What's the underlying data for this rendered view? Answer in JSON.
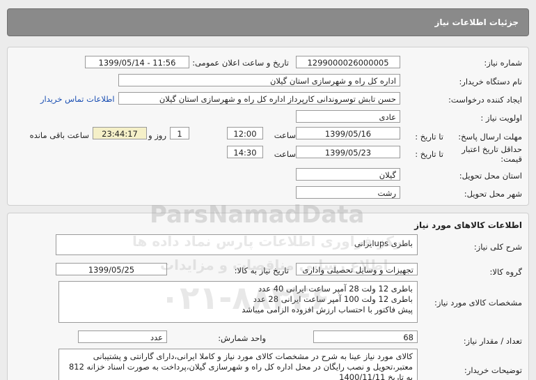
{
  "header": {
    "title": "جزئیات اطلاعات نیاز"
  },
  "need": {
    "need_number_label": "شماره نیاز:",
    "need_number": "1299000026000005",
    "announce_label": "تاریخ و ساعت اعلان عمومی:",
    "announce_value": "1399/05/14 - 11:56",
    "buyer_label": "نام دستگاه خریدار:",
    "buyer_value": "اداره کل راه و شهرسازی استان گیلان",
    "creator_label": "ایجاد کننده درخواست:",
    "creator_value": "حسن تابش توسروندانی کارپرداز اداره کل راه و شهرسازی استان گیلان",
    "contact_link": "اطلاعات تماس خریدار",
    "priority_label": "اولویت نیاز :",
    "priority_value": "عادی",
    "deadline_label": "مهلت ارسال پاسخ:",
    "to_date_label": "تا تاریخ :",
    "deadline_date": "1399/05/16",
    "time_label": "ساعت",
    "deadline_time": "12:00",
    "days_value": "1",
    "days_label": "روز و",
    "remaining_time": "23:44:17",
    "remaining_label": "ساعت باقی مانده",
    "validity_label": "حداقل تاریخ اعتبار قیمت:",
    "validity_date": "1399/05/23",
    "validity_time": "14:30",
    "province_label": "استان محل تحویل:",
    "province_value": "گیلان",
    "city_label": "شهر محل تحویل:",
    "city_value": "رشت"
  },
  "goods": {
    "section_title": "اطلاعات کالاهای مورد نیاز",
    "desc_label": "شرح کلی نیاز:",
    "desc_value": "باطری upsایرانی",
    "group_label": "گروه کالا:",
    "group_value": "تجهیزات و وسایل تحصیلی واداری",
    "need_date_label": "تاریخ نیاز به کالا:",
    "need_date_value": "1399/05/25",
    "spec_label": "مشخصات کالای مورد نیاز:",
    "spec_lines": [
      "باطری 12 ولت 28 آمپر ساعت ایرانی 40 عدد",
      "باطری 12 ولت 100 آمپر ساعت ایرانی 28 عدد",
      "پیش فاکتور با احتساب ارزش افزوده الزامی میباشد"
    ],
    "qty_label": "تعداد / مقدار نیاز:",
    "qty_value": "68",
    "unit_label": "واحد شمارش:",
    "unit_value": "عدد",
    "buyer_notes_label": "توضیحات خریدار:",
    "buyer_notes_lines": [
      "کالای مورد نیاز عینا به شرح در مشخصات کالای مورد نیاز و کاملا ایرانی،دارای گارانتی و پشتیبانی",
      "معتبر،تحویل و نصب رایگان در محل اداره کل راه و شهرسازی گیلان،پرداخت به صورت اسناد خزانه 812",
      "به تاریخ 1400/11/11"
    ]
  },
  "watermark": {
    "brand": "ParsNamadData",
    "persian": "مرکز فراوری اطلاعات پارس نماد داده ها",
    "persian2": "اطلاع رسانی مناقصات و مزایدات",
    "phone": "۰۲۱-۸۸۳۴۶"
  }
}
